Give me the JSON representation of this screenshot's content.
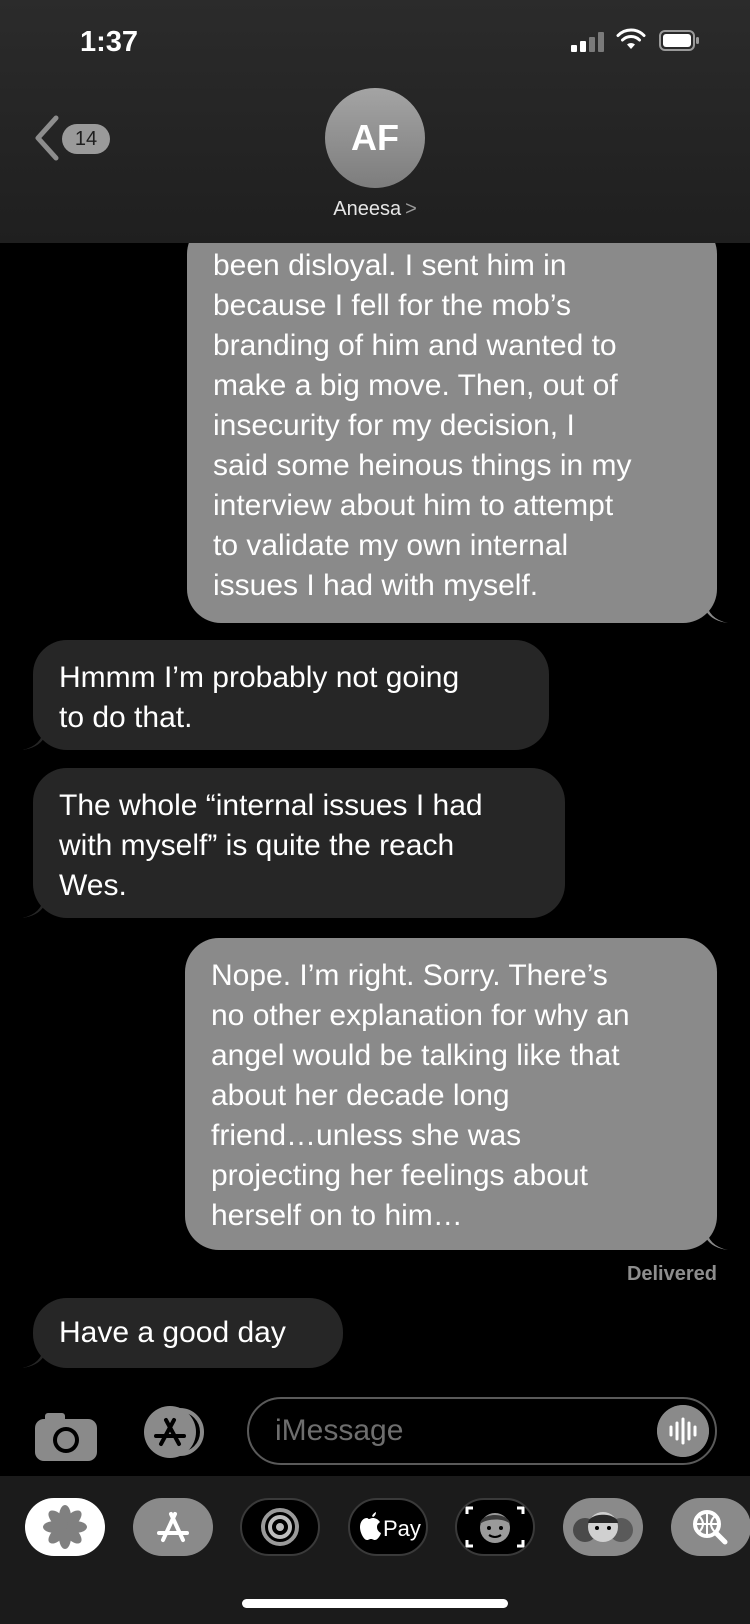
{
  "status_bar": {
    "time": "1:37"
  },
  "nav": {
    "back_badge": "14",
    "avatar_initials": "AF",
    "contact_name": "Aneesa",
    "contact_chevron": ">"
  },
  "messages": [
    {
      "from": "me",
      "text": "been disloyal. I sent him in\nbecause I fell for the mob’s\nbranding of him and wanted to\nmake a big move. Then, out of\ninsecurity for my decision, I\nsaid some heinous things in my\ninterview about him to attempt\nto validate my own internal\nissues I had with myself."
    },
    {
      "from": "them",
      "text": "Hmmm I’m probably not going\nto do that."
    },
    {
      "from": "them",
      "text": "The whole “internal issues I had\nwith myself” is quite the reach\nWes."
    },
    {
      "from": "me",
      "text": "Nope. I’m right. Sorry. There’s\nno other explanation for why an\nangel would be talking like that\nabout her decade long\nfriend…unless she was\nprojecting her feelings about\nherself on to him…"
    },
    {
      "from": "them",
      "text": "Have a good day"
    }
  ],
  "delivered_label": "Delivered",
  "composer": {
    "placeholder": "iMessage"
  },
  "app_drawer": {
    "apps": [
      "photos-app",
      "app-store",
      "digital-touch",
      "apple-pay",
      "memoji-stickers",
      "animoji",
      "search-images"
    ],
    "apple_pay_label": "Pay"
  }
}
